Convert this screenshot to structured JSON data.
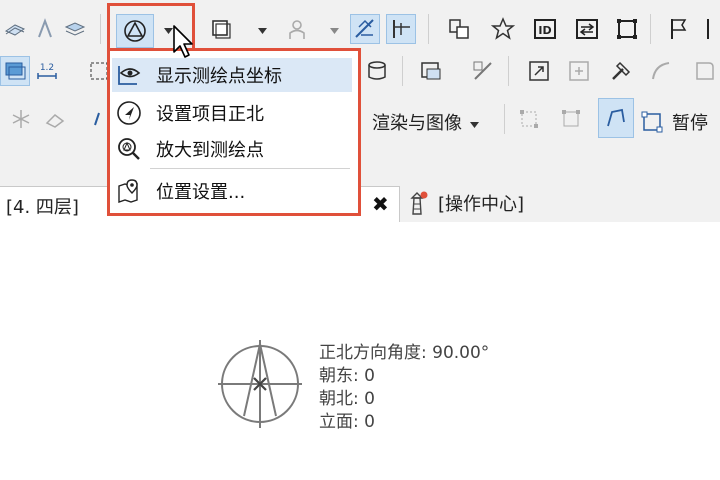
{
  "toolbar": {
    "render_label": "渲染与图像",
    "pause_label": "暂停"
  },
  "menu": {
    "items": [
      {
        "label": "显示测绘点坐标",
        "icon": "eye-coordinate-icon"
      },
      {
        "label": "设置项目正北",
        "icon": "compass-north-icon"
      },
      {
        "label": "放大到测绘点",
        "icon": "zoom-survey-point-icon"
      },
      {
        "label": "位置设置...",
        "icon": "map-pin-icon"
      }
    ]
  },
  "tabs": {
    "active_label": "[4. 四层]",
    "close_glyph": "✖",
    "second_label": "[操作中心]"
  },
  "survey_point": {
    "angle_line": "正北方向角度: 90.00°",
    "east_line": "朝东: 0",
    "north_line": "朝北: 0",
    "elevation_line": "立面: 0"
  },
  "colors": {
    "highlight_frame": "#e0503a",
    "selection_bg": "#cfe3f5",
    "menu_hover_bg": "#dbe8f6",
    "notification_dot": "#e0503a"
  }
}
